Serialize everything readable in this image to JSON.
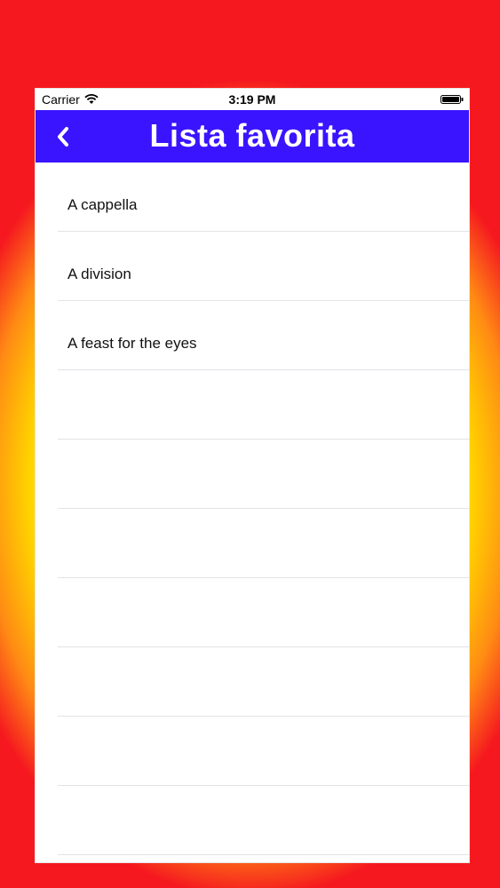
{
  "status_bar": {
    "carrier": "Carrier",
    "time": "3:19 PM",
    "icons": [
      "wifi-icon",
      "battery-icon"
    ]
  },
  "nav": {
    "title": "Lista favorita",
    "back_icon": "chevron-left-icon",
    "color": "#3a14ff"
  },
  "list": {
    "items": [
      {
        "label": "A cappella"
      },
      {
        "label": "A division"
      },
      {
        "label": "A feast for the eyes"
      },
      {
        "label": ""
      },
      {
        "label": ""
      },
      {
        "label": ""
      },
      {
        "label": ""
      },
      {
        "label": ""
      },
      {
        "label": ""
      },
      {
        "label": ""
      }
    ]
  }
}
